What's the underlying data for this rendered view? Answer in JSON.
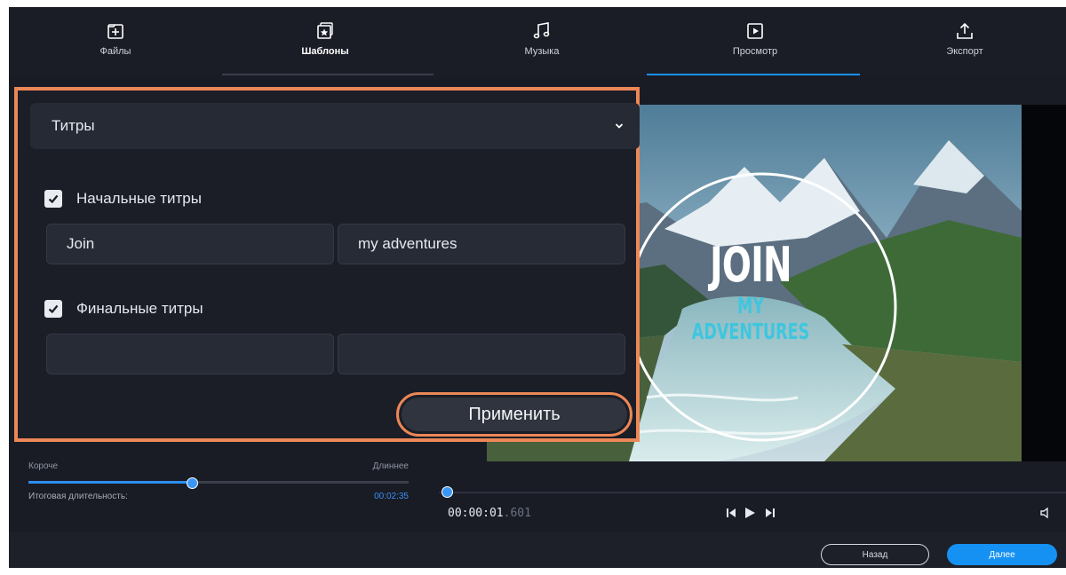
{
  "toolbar": {
    "tabs": [
      {
        "label": "Файлы",
        "icon": "add-file-icon"
      },
      {
        "label": "Шаблоны",
        "icon": "templates-icon",
        "active": true
      },
      {
        "label": "Музыка",
        "icon": "music-note-icon"
      },
      {
        "label": "Просмотр",
        "icon": "play-preview-icon"
      },
      {
        "label": "Экспорт",
        "icon": "export-icon"
      }
    ]
  },
  "titles_panel": {
    "section_select": "Титры",
    "opening_titles": {
      "checked": true,
      "label": "Начальные титры",
      "field1": "Join",
      "field2": "my adventures"
    },
    "closing_titles": {
      "checked": true,
      "label": "Финальные титры",
      "field1": "",
      "field2": ""
    },
    "apply_button": "Применить"
  },
  "preview": {
    "title_line1": "JOIN",
    "title_line2": "MY ADVENTURES"
  },
  "duration": {
    "shorter": "Короче",
    "longer": "Длиннее",
    "slider_fraction": 0.43,
    "total_label": "Итоговая длительность:",
    "total_value": "00:02:35"
  },
  "player": {
    "timecode_main": "00:00:01",
    "timecode_ms": ".601",
    "progress_fraction": 0.005
  },
  "footer": {
    "back": "Назад",
    "next": "Далее"
  },
  "colors": {
    "accent": "#1591f3",
    "highlight": "#ec8757",
    "app_bg": "#191c25",
    "title_cyan": "#3fc6df"
  }
}
